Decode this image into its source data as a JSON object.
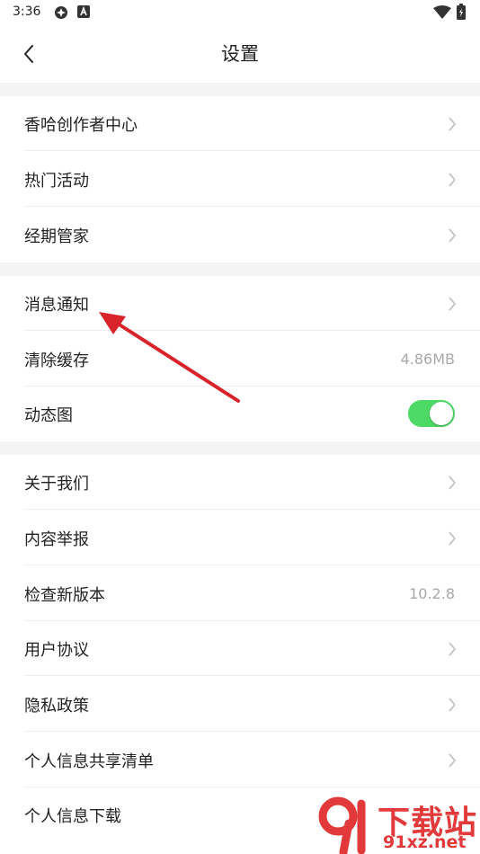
{
  "status_bar": {
    "time": "3:36"
  },
  "header": {
    "title": "设置"
  },
  "sections": [
    {
      "items": [
        {
          "label": "香哈创作者中心",
          "type": "link"
        },
        {
          "label": "热门活动",
          "type": "link"
        },
        {
          "label": "经期管家",
          "type": "link"
        }
      ]
    },
    {
      "items": [
        {
          "label": "消息通知",
          "type": "link"
        },
        {
          "label": "清除缓存",
          "type": "value",
          "value": "4.86MB"
        },
        {
          "label": "动态图",
          "type": "toggle",
          "enabled": true
        }
      ]
    },
    {
      "items": [
        {
          "label": "关于我们",
          "type": "link"
        },
        {
          "label": "内容举报",
          "type": "link"
        },
        {
          "label": "检查新版本",
          "type": "value",
          "value": "10.2.8"
        },
        {
          "label": "用户协议",
          "type": "link"
        },
        {
          "label": "隐私政策",
          "type": "link"
        },
        {
          "label": "个人信息共享清单",
          "type": "link"
        },
        {
          "label": "个人信息下载",
          "type": "link"
        }
      ]
    }
  ],
  "colors": {
    "toggle_on": "#4cd964",
    "annotation_arrow": "#d9232a",
    "section_gap": "#f4f4f4"
  },
  "watermark": {
    "brand": "下载站",
    "site": "91xz.net",
    "logo": "91"
  }
}
